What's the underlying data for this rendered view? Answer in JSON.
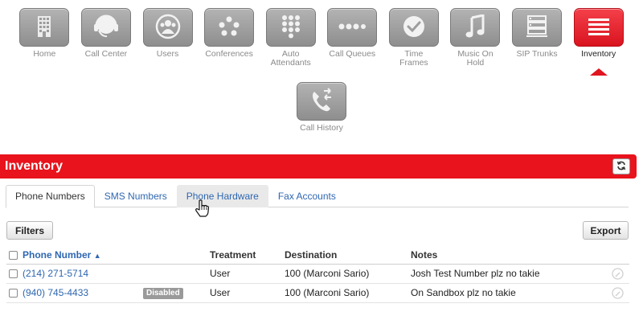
{
  "nav": {
    "items": [
      {
        "label": "Home",
        "icon": "building-icon"
      },
      {
        "label": "Call Center",
        "icon": "headset-icon"
      },
      {
        "label": "Users",
        "icon": "users-icon"
      },
      {
        "label": "Conferences",
        "icon": "conference-icon"
      },
      {
        "label": "Auto\nAttendants",
        "icon": "keypad-icon"
      },
      {
        "label": "Call Queues",
        "icon": "queue-icon"
      },
      {
        "label": "Time\nFrames",
        "icon": "clock-icon"
      },
      {
        "label": "Music On\nHold",
        "icon": "music-note-icon"
      },
      {
        "label": "SIP Trunks",
        "icon": "server-icon"
      },
      {
        "label": "Inventory",
        "icon": "list-icon",
        "active": true
      }
    ],
    "second_row": [
      {
        "label": "Call History",
        "icon": "call-history-icon"
      }
    ]
  },
  "inventory": {
    "title": "Inventory",
    "tabs": [
      "Phone Numbers",
      "SMS Numbers",
      "Phone Hardware",
      "Fax Accounts"
    ],
    "active_tab": "Phone Numbers",
    "hover_tab": "Phone Hardware",
    "filters_label": "Filters",
    "export_label": "Export"
  },
  "table": {
    "columns": {
      "number": "Phone Number",
      "sort_indicator": "▲",
      "treatment": "Treatment",
      "destination": "Destination",
      "notes": "Notes"
    },
    "rows": [
      {
        "number": "(214) 271-5714",
        "badge": "",
        "treatment": "User",
        "destination": "100 (Marconi Sario)",
        "notes": "Josh Test Number plz no takie"
      },
      {
        "number": "(940) 745-4433",
        "badge": "Disabled",
        "treatment": "User",
        "destination": "100 (Marconi Sario)",
        "notes": "On Sandbox plz no takie"
      }
    ]
  },
  "colors": {
    "accent": "#e8131c",
    "link": "#2f67b1",
    "tile": "#9e9e9e"
  }
}
